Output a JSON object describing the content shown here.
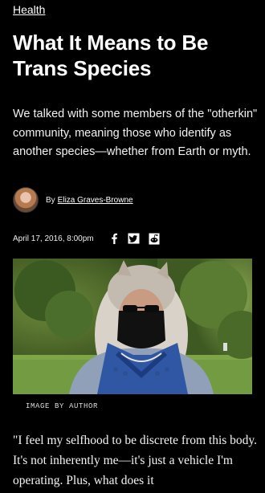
{
  "article": {
    "category": "Health",
    "title": "What It Means to Be Trans Species",
    "dek": "We talked with some members of the \"otherkin\" community, meaning those who identify as another species—whether from Earth or myth.",
    "byline_prefix": "By",
    "author": "Eliza Graves-Browne",
    "date": "April 17, 2016, 8:00pm",
    "image_caption": "IMAGE BY AUTHOR",
    "body_excerpt": "\"I feel my selfhood to be discrete from this body. It's not inherently me—it's just a vehicle I'm operating. Plus, what does it"
  },
  "share": {
    "icons": [
      "facebook-icon",
      "twitter-icon",
      "reddit-icon"
    ]
  },
  "colors": {
    "background": "#000000",
    "text": "#ffffff"
  }
}
